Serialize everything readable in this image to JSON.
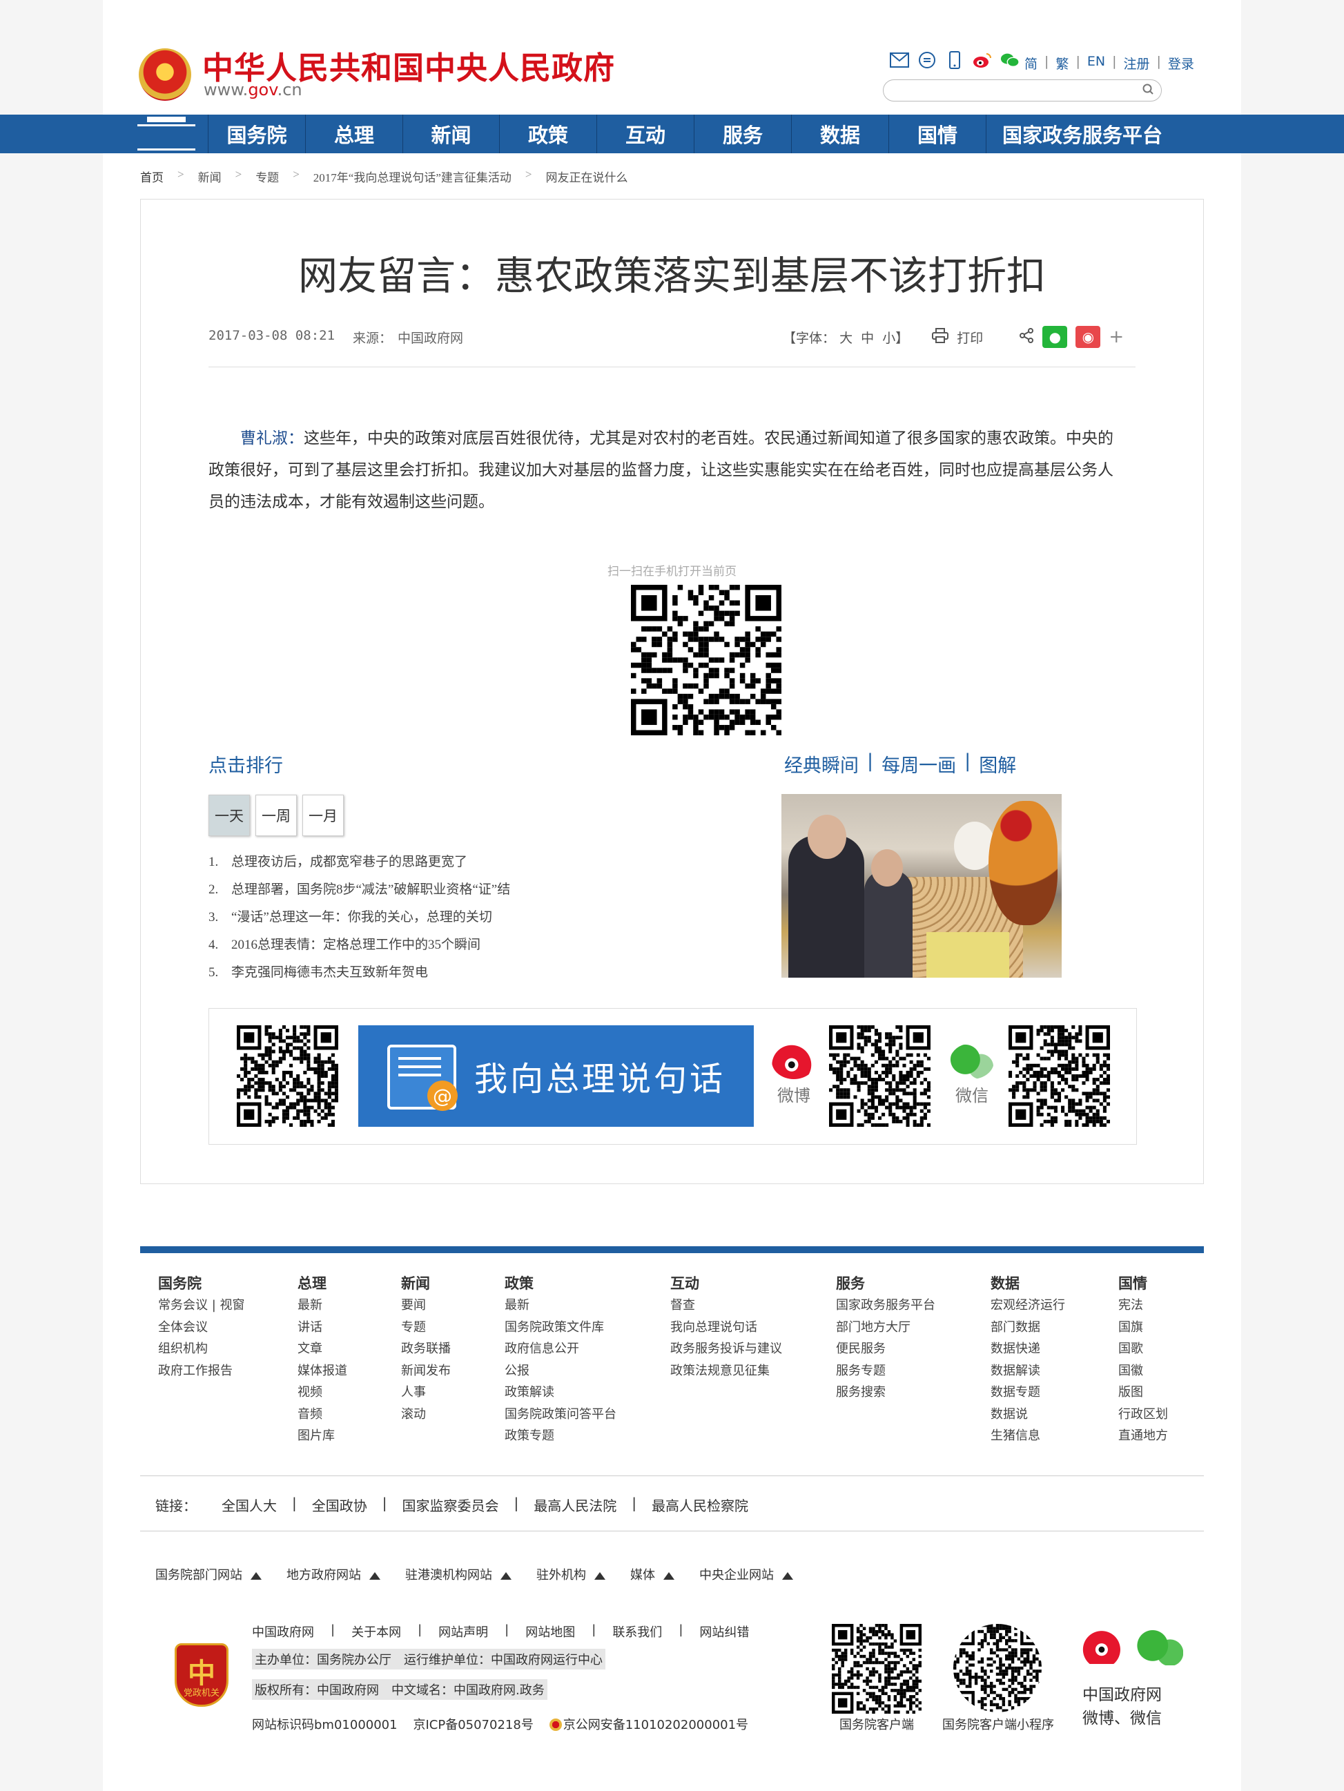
{
  "header": {
    "site_title": "中华人民共和国中央人民政府",
    "site_url_prefix": "www.",
    "site_url_domain": "gov",
    "site_url_suffix": ".cn",
    "icons": [
      "mail-icon",
      "chat-icon",
      "mobile-icon",
      "weibo-icon",
      "wechat-icon"
    ],
    "top_links": [
      "简",
      "繁",
      "EN",
      "注册",
      "登录"
    ],
    "search_placeholder": ""
  },
  "nav": {
    "items": [
      "国务院",
      "总理",
      "新闻",
      "政策",
      "互动",
      "服务",
      "数据",
      "国情",
      "国家政务服务平台"
    ]
  },
  "breadcrumb": [
    "首页",
    "新闻",
    "专题",
    "2017年“我向总理说句话”建言征集活动",
    "网友正在说什么"
  ],
  "article": {
    "title": "网友留言：惠农政策落实到基层不该打折扣",
    "date": "2017-03-08 08:21",
    "source_label": "来源：",
    "source": "中国政府网",
    "font_label": "【字体：",
    "font_big": "大",
    "font_mid": "中",
    "font_small": "小】",
    "print": "打印",
    "plus": "+",
    "author": "曹礼淑：",
    "body": "这些年，中央的政策对底层百姓很优待，尤其是对农村的老百姓。农民通过新闻知道了很多国家的惠农政策。中央的政策很好，可到了基层这里会打折扣。我建议加大对基层的监督力度，让这些实惠能实实在在给老百姓，同时也应提高基层公务人员的违法成本，才能有效遏制这些问题。",
    "qr_hint": "扫一扫在手机打开当前页"
  },
  "ranking": {
    "title": "点击排行",
    "tabs": [
      "一天",
      "一周",
      "一月"
    ],
    "active_tab": "一天",
    "items": [
      {
        "n": "1.",
        "text": "总理夜访后，成都宽窄巷子的思路更宽了"
      },
      {
        "n": "2.",
        "text": "总理部署，国务院8步“减法”破解职业资格“证”结"
      },
      {
        "n": "3.",
        "text": "“漫话”总理这一年：你我的关心，总理的关切"
      },
      {
        "n": "4.",
        "text": "2016总理表情：定格总理工作中的35个瞬间"
      },
      {
        "n": "5.",
        "text": "李克强同梅德韦杰夫互致新年贺电"
      }
    ]
  },
  "gallery": {
    "links": [
      "经典瞬间",
      "每周一画",
      "图解"
    ]
  },
  "promo": {
    "banner_text": "我向总理说句话",
    "weibo": "微博",
    "weixin": "微信"
  },
  "footer": {
    "columns": [
      {
        "title": "国务院",
        "items": [
          "常务会议 | 视窗",
          "全体会议",
          "组织机构",
          "政府工作报告"
        ]
      },
      {
        "title": "总理",
        "items": [
          "最新",
          "讲话",
          "文章",
          "媒体报道",
          "视频",
          "音频",
          "图片库"
        ]
      },
      {
        "title": "新闻",
        "items": [
          "要闻",
          "专题",
          "政务联播",
          "新闻发布",
          "人事",
          "滚动"
        ]
      },
      {
        "title": "政策",
        "items": [
          "最新",
          "国务院政策文件库",
          "政府信息公开",
          "公报",
          "政策解读",
          "国务院政策问答平台",
          "政策专题"
        ]
      },
      {
        "title": "互动",
        "items": [
          "督查",
          "我向总理说句话",
          "政务服务投诉与建议",
          "政策法规意见征集"
        ]
      },
      {
        "title": "服务",
        "items": [
          "国家政务服务平台",
          "部门地方大厅",
          "便民服务",
          "服务专题",
          "服务搜索"
        ]
      },
      {
        "title": "数据",
        "items": [
          "宏观经济运行",
          "部门数据",
          "数据快递",
          "数据解读",
          "数据专题",
          "数据说",
          "生猪信息"
        ]
      },
      {
        "title": "国情",
        "items": [
          "宪法",
          "国旗",
          "国歌",
          "国徽",
          "版图",
          "行政区划",
          "直通地方"
        ]
      }
    ],
    "links_label": "链接：",
    "links": [
      "全国人大",
      "全国政协",
      "国家监察委员会",
      "最高人民法院",
      "最高人民检察院"
    ],
    "sites": [
      "国务院部门网站",
      "地方政府网站",
      "驻港澳机构网站",
      "驻外机构",
      "媒体",
      "中央企业网站"
    ],
    "badge_text": "党政机关",
    "bottom_links": [
      "中国政府网",
      "关于本网",
      "网站声明",
      "网站地图",
      "联系我们",
      "网站纠错"
    ],
    "sponsor": "主办单位：国务院办公厅　运行维护单位：中国政府网运行中心",
    "copyright": "版权所有：中国政府网　中文域名：中国政府网.政务",
    "site_id": "网站标识码bm01000001",
    "icp": "京ICP备05070218号",
    "police": "京公网安备11010202000001号",
    "qr1_label": "国务院客户端",
    "qr2_label": "国务院客户端小程序",
    "social_line1": "中国政府网",
    "social_line2": "微博、微信"
  }
}
